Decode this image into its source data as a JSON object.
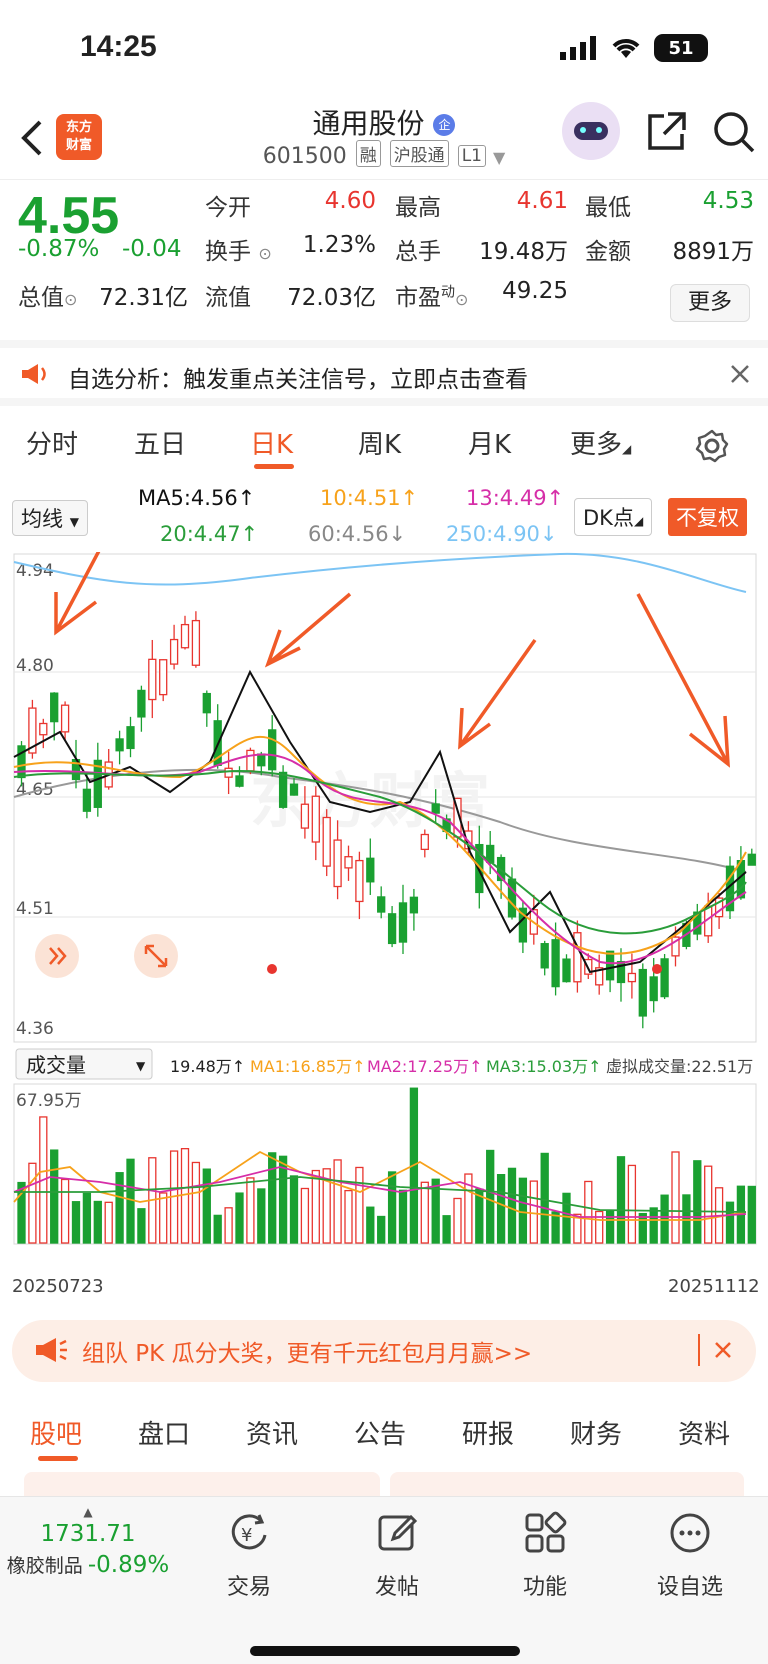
{
  "status_bar": {
    "time": "14:25",
    "battery": "51"
  },
  "header": {
    "logo_line1": "东方",
    "logo_line2": "财富",
    "stock_name": "通用股份",
    "badge": "企",
    "code": "601500",
    "tags": [
      "融",
      "沪股通",
      "L1"
    ]
  },
  "quote": {
    "price": "4.55",
    "change_pct": "-0.87%",
    "change": "-0.04",
    "fields": {
      "open_label": "今开",
      "open": "4.60",
      "high_label": "最高",
      "high": "4.61",
      "low_label": "最低",
      "low": "4.53",
      "turnover_label": "换手",
      "turnover": "1.23%",
      "volume_label": "总手",
      "volume": "19.48万",
      "amount_label": "金额",
      "amount": "8891万",
      "mcap_label": "总值",
      "mcap": "72.31亿",
      "float_label": "流值",
      "float": "72.03亿",
      "pe_label": "市盈",
      "pe_sup": "动",
      "pe": "49.25"
    },
    "more_label": "更多"
  },
  "notice": {
    "text": "自选分析：触发重点关注信号，立即点击查看"
  },
  "chart_tabs": [
    {
      "label": "分时",
      "active": false
    },
    {
      "label": "五日",
      "active": false
    },
    {
      "label": "日K",
      "active": true
    },
    {
      "label": "周K",
      "active": false
    },
    {
      "label": "月K",
      "active": false
    },
    {
      "label": "更多",
      "active": false
    }
  ],
  "ma_row": {
    "selector": "均线",
    "ma5": "MA5:4.56↑",
    "ma10": "10:4.51↑",
    "ma13": "13:4.49↑",
    "ma20": "20:4.47↑",
    "ma60": "60:4.56↓",
    "ma250": "250:4.90↓",
    "dk_label": "DK点",
    "fq_label": "不复权"
  },
  "price_axis": [
    "4.94",
    "4.80",
    "4.65",
    "4.51",
    "4.36"
  ],
  "volume_bar": {
    "selector": "成交量",
    "vol": "19.48万↑",
    "ma1": "MA1:16.85万↑",
    "ma2": "MA2:17.25万↑",
    "ma3": "MA3:15.03万↑",
    "virtual": "虚拟成交量:22.51万",
    "max": "67.95万"
  },
  "dates": {
    "start": "20250723",
    "end": "20251112"
  },
  "colors": {
    "up": "#e8352f",
    "down": "#1aa031",
    "accent": "#f05a28",
    "ma5": "#111111",
    "ma10": "#f7a21b",
    "ma13": "#d62ea8",
    "ma20": "#2a9d3a",
    "ma60": "#999999",
    "ma250": "#7cc4f4"
  },
  "promo": {
    "text": "组队 PK 瓜分大奖，更有千元红包月月赢>>"
  },
  "bottom_tabs": [
    "股吧",
    "盘口",
    "资讯",
    "公告",
    "研报",
    "财务",
    "资料"
  ],
  "toolbar": {
    "index_value": "1731.71",
    "index_name": "橡胶制品",
    "index_change": "-0.89%",
    "items": [
      "交易",
      "发帖",
      "功能",
      "设自选"
    ]
  }
}
